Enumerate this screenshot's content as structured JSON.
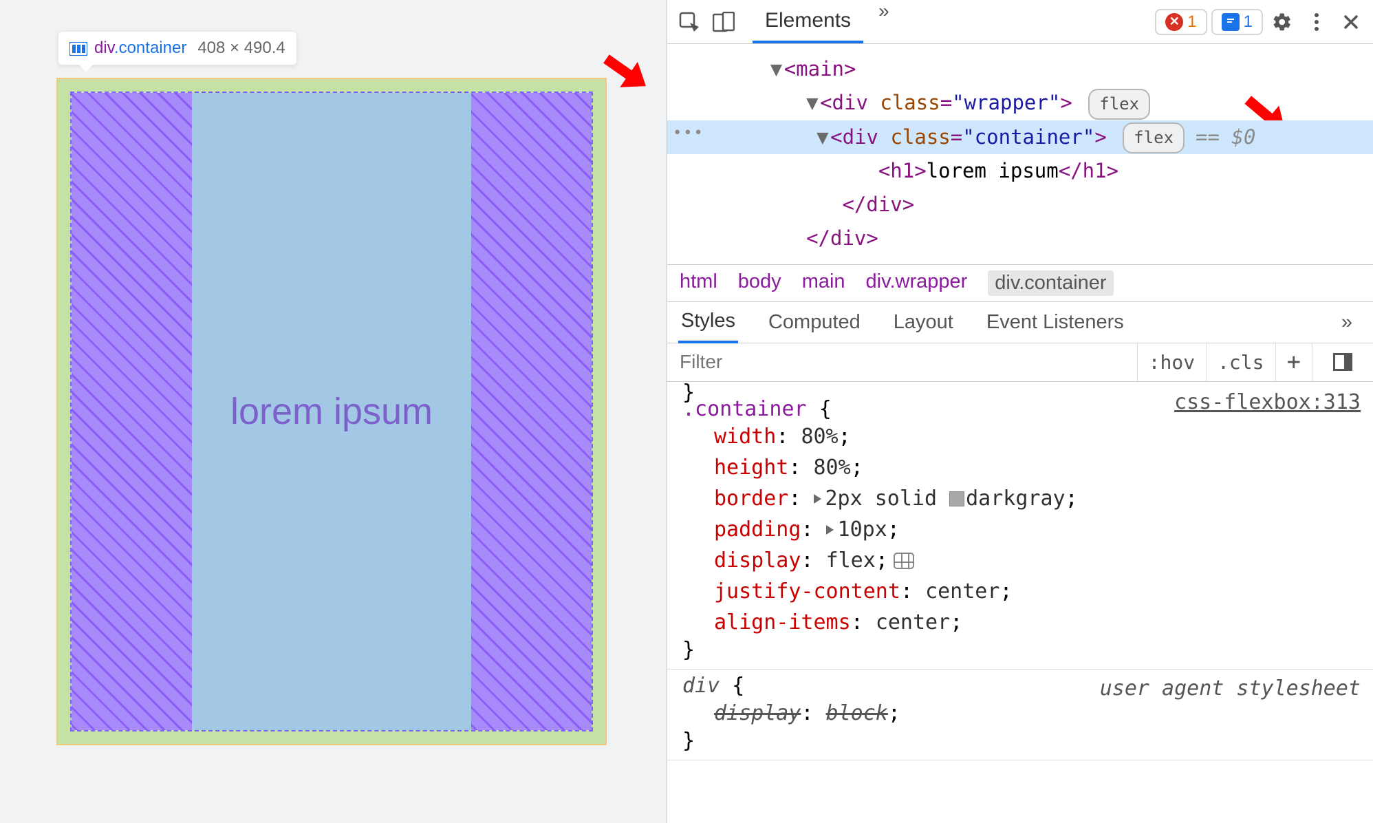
{
  "tooltip": {
    "tag": "div",
    "cls": ".container",
    "dims": "408 × 490.4"
  },
  "viewport": {
    "content_text": "lorem ipsum"
  },
  "toolbar": {
    "tabs": {
      "elements": "Elements"
    },
    "error_count": "1",
    "msg_count": "1"
  },
  "dom": {
    "main_open": "<main>",
    "wrapper_open_tag": "div",
    "wrapper_open_attr": "class",
    "wrapper_open_val": "\"wrapper\"",
    "badge_flex": "flex",
    "container_open_tag": "div",
    "container_open_attr": "class",
    "container_open_val": "\"container\"",
    "eq_sel": "== $0",
    "h1_tag": "h1",
    "h1_text": "lorem ipsum",
    "div_close": "</div>",
    "div_close2": "</div>"
  },
  "breadcrumb": {
    "items": [
      "html",
      "body",
      "main",
      "div.wrapper",
      "div.container"
    ]
  },
  "subtabs": {
    "styles": "Styles",
    "computed": "Computed",
    "layout": "Layout",
    "event_listeners": "Event Listeners"
  },
  "filter": {
    "placeholder": "Filter",
    "hov": ":hov",
    "cls": ".cls"
  },
  "styles": {
    "rule1": {
      "selector": ".container",
      "source": "css-flexbox:313",
      "decls": [
        {
          "prop": "width",
          "val": "80%"
        },
        {
          "prop": "height",
          "val": "80%"
        },
        {
          "prop": "border",
          "val_pre": "2px solid ",
          "swatch": true,
          "val_post": "darkgray",
          "expand": true
        },
        {
          "prop": "padding",
          "val": "10px",
          "expand": true
        },
        {
          "prop": "display",
          "val": "flex",
          "grid_icon": true
        },
        {
          "prop": "justify-content",
          "val": "center"
        },
        {
          "prop": "align-items",
          "val": "center"
        }
      ]
    },
    "rule2": {
      "selector": "div",
      "source": "user agent stylesheet",
      "decl_strike": {
        "prop": "display",
        "val": "block"
      }
    }
  }
}
